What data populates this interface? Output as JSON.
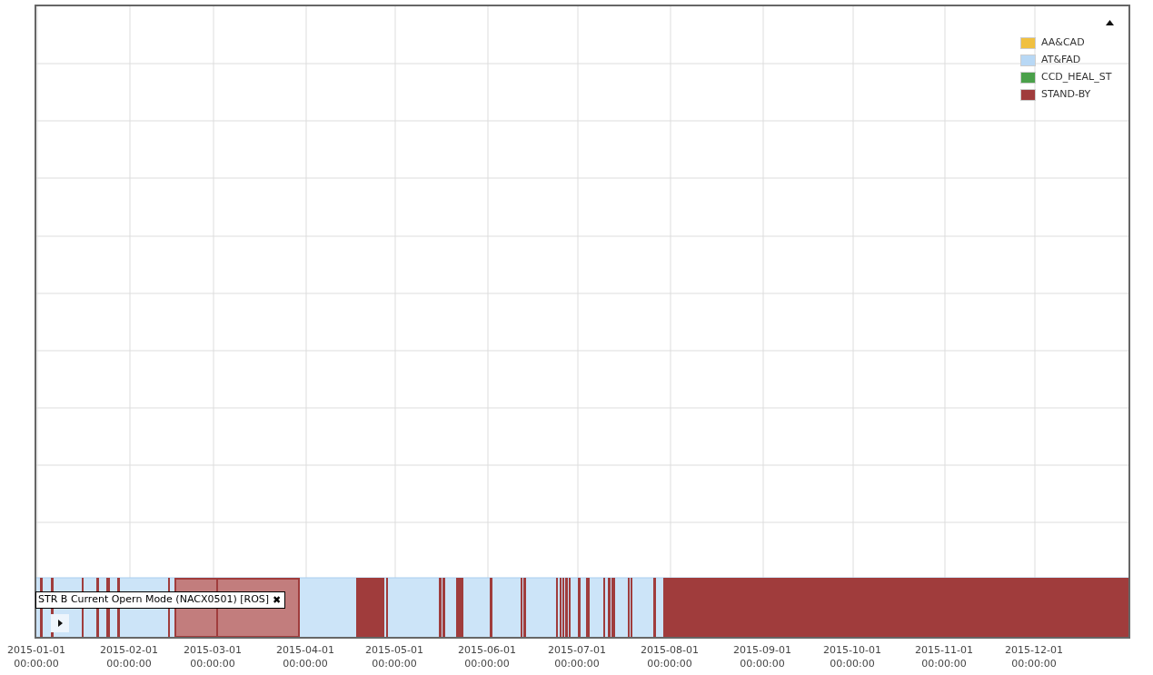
{
  "legend": {
    "expanded": true,
    "items": [
      {
        "label": "AA&CAD",
        "color": "#f0c040"
      },
      {
        "label": "AT&FAD",
        "color": "#b8d8f5"
      },
      {
        "label": "CCD_HEAL_ST",
        "color": "#4aa04a"
      },
      {
        "label": "STAND-BY",
        "color": "#a03c3c"
      }
    ]
  },
  "track": {
    "label": "STR B Current Opern Mode (NACX0501) [ROS]",
    "close": "✖"
  },
  "x_ticks": [
    {
      "date": "2015-01-01",
      "time": "00:00:00"
    },
    {
      "date": "2015-02-01",
      "time": "00:00:00"
    },
    {
      "date": "2015-03-01",
      "time": "00:00:00"
    },
    {
      "date": "2015-04-01",
      "time": "00:00:00"
    },
    {
      "date": "2015-05-01",
      "time": "00:00:00"
    },
    {
      "date": "2015-06-01",
      "time": "00:00:00"
    },
    {
      "date": "2015-07-01",
      "time": "00:00:00"
    },
    {
      "date": "2015-08-01",
      "time": "00:00:00"
    },
    {
      "date": "2015-09-01",
      "time": "00:00:00"
    },
    {
      "date": "2015-10-01",
      "time": "00:00:00"
    },
    {
      "date": "2015-11-01",
      "time": "00:00:00"
    },
    {
      "date": "2015-12-01",
      "time": "00:00:00"
    }
  ]
}
